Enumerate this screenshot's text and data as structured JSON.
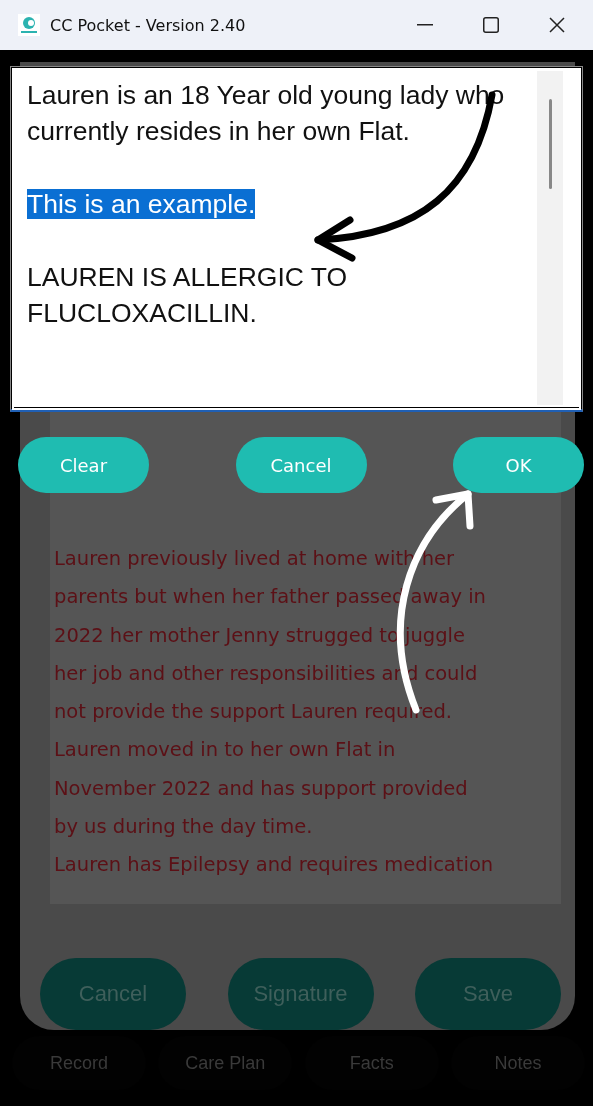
{
  "window": {
    "title": "CC Pocket - Version 2.40"
  },
  "editor": {
    "paragraphs": [
      {
        "text": "Lauren is an 18 Year old young lady who currently resides in her own Flat.",
        "selected": false
      },
      {
        "text": "This is an example.",
        "selected": true
      },
      {
        "text": "LAUREN IS ALLERGIC TO FLUCLOXACILLIN.",
        "selected": false
      }
    ]
  },
  "dialog_buttons": [
    "Clear",
    "Cancel",
    "OK"
  ],
  "note_lines": [
    "Lauren previously lived at home with her",
    "parents but when her father passed away in",
    "2022 her mother Jenny strugged to juggle",
    "her job and other responsibilities and could",
    "not provide the support Lauren required.",
    "Lauren moved in to her own Flat in",
    "November 2022 and has support provided",
    "by us during the day time.",
    "Lauren has Epilepsy and requires medication"
  ],
  "form_buttons": [
    "Cancel",
    "Signature",
    "Save"
  ],
  "tabs": [
    "Record",
    "Care Plan",
    "Facts",
    "Notes"
  ]
}
